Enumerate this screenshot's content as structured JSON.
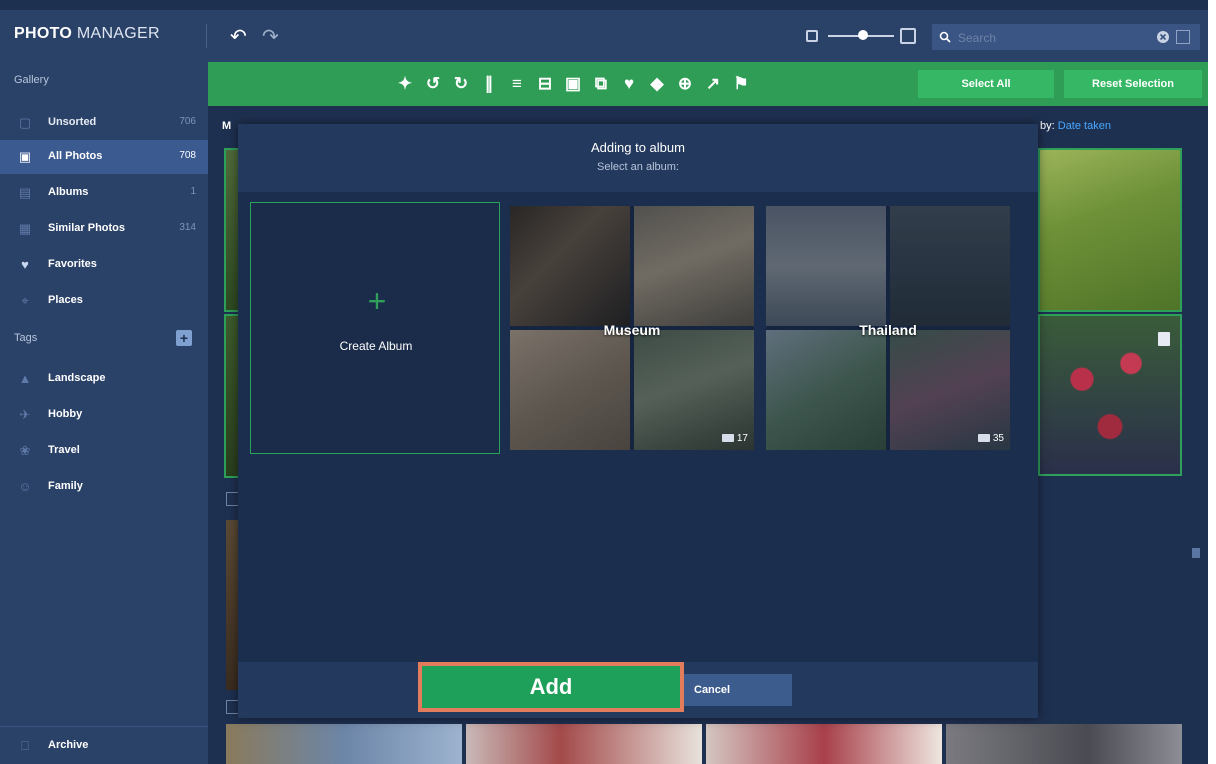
{
  "app": {
    "title_bold": "PHOTO",
    "title_light": " MANAGER"
  },
  "search": {
    "placeholder": "Search"
  },
  "sidebar": {
    "gallery_heading": "Gallery",
    "items": [
      {
        "label": "Unsorted",
        "count": "706",
        "icon": "unsorted-icon"
      },
      {
        "label": "All Photos",
        "count": "708",
        "icon": "photos-icon"
      },
      {
        "label": "Albums",
        "count": "1",
        "icon": "albums-icon"
      },
      {
        "label": "Similar Photos",
        "count": "314",
        "icon": "similar-icon"
      },
      {
        "label": "Favorites",
        "count": "",
        "icon": "heart-icon"
      },
      {
        "label": "Places",
        "count": "",
        "icon": "pin-icon"
      }
    ],
    "tags_heading": "Tags",
    "tags": [
      {
        "label": "Landscape",
        "icon": "landscape-icon"
      },
      {
        "label": "Hobby",
        "icon": "plane-icon"
      },
      {
        "label": "Travel",
        "icon": "palm-icon"
      },
      {
        "label": "Family",
        "icon": "family-icon"
      }
    ],
    "archive": "Archive"
  },
  "toolbar": {
    "select_all": "Select All",
    "reset_selection": "Reset Selection"
  },
  "main": {
    "label": "M",
    "sort_prefix": "by:",
    "sort_value": "Date taken"
  },
  "modal": {
    "title": "Adding to album",
    "subtitle": "Select an album:",
    "create_label": "Create Album",
    "albums": [
      {
        "name": "Museum",
        "count": "17"
      },
      {
        "name": "Thailand",
        "count": "35"
      }
    ],
    "add": "Add",
    "cancel": "Cancel"
  },
  "colors": {
    "accent_green": "#2f9d55",
    "highlight_orange": "#e27c5c",
    "link_blue": "#49a7ff"
  }
}
